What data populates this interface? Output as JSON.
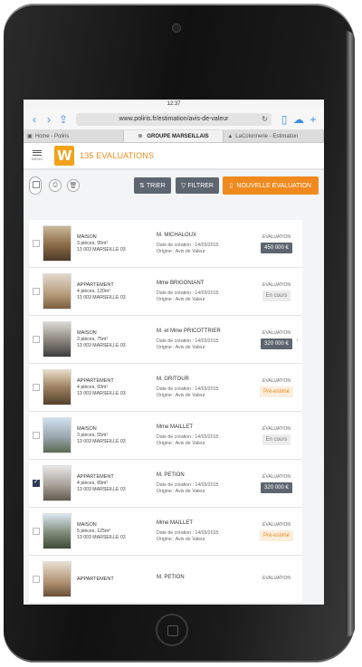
{
  "browser": {
    "time": "12:37",
    "url": "www.poliris.fr/estimation/avis-de-valeur",
    "tabs": [
      {
        "label": "Home - Poliris"
      },
      {
        "label": "GROUPE MARSEILLAIS"
      },
      {
        "label": "LaColonnerie - Estimation"
      }
    ]
  },
  "app": {
    "menu_label": "MENU",
    "evaluations_count": "135 EVALUATIONS"
  },
  "actions": {
    "sort_label": "TRIER",
    "filter_label": "FILTRER",
    "new_label": "NOUVELLE EVALUATION"
  },
  "colors": {
    "accent": "#f08a1f",
    "dark_button": "#5d6670"
  },
  "listings": [
    {
      "type": "MAISON",
      "details": "3 pièces, 95m²",
      "city": "13 003 MARSEILLE 03",
      "owner": "M. MICHALOUX",
      "created": "Date de création : 14/03/2015",
      "origin": "Origine : Avis de Valeur",
      "eval_label": "EVALUATION",
      "status": "450 000 €",
      "status_kind": "price",
      "checked": false
    },
    {
      "type": "APPARTEMENT",
      "details": "4 pièces, 120m²",
      "city": "13 003 MARSEILLE 03",
      "owner": "Mme BRIGONIANT",
      "created": "Date de création : 14/03/2015",
      "origin": "Origine : Avis de Valeur",
      "eval_label": "EVALUATION",
      "status": "En cours",
      "status_kind": "encours",
      "checked": false
    },
    {
      "type": "MAISON",
      "details": "3 pièces, 75m²",
      "city": "13 003 MARSEILLE 03",
      "owner": "M. et Mme PRICOTTRIER",
      "created": "Date de création : 14/03/2015",
      "origin": "Origine : Avis de Valeur",
      "eval_label": "EVALUATION",
      "status": "320 000 €",
      "status_kind": "price",
      "checked": false
    },
    {
      "type": "APPARTEMENT",
      "details": "4 pièces, 93m²",
      "city": "13 003 MARSEILLE 03",
      "owner": "M. GRITOUR",
      "created": "Date de création : 14/03/2015",
      "origin": "Origine : Avis de Valeur",
      "eval_label": "EVALUATION",
      "status": "Pré-estimé",
      "status_kind": "pre",
      "checked": false
    },
    {
      "type": "MAISON",
      "details": "3 pièces, 55m²",
      "city": "13 003 MARSEILLE 03",
      "owner": "Mme MAILLET",
      "created": "Date de création : 14/03/2015",
      "origin": "Origine : Avis de Valeur",
      "eval_label": "EVALUATION",
      "status": "En cours",
      "status_kind": "encours",
      "checked": false
    },
    {
      "type": "APPARTEMENT",
      "details": "4 pièces, 89m²",
      "city": "13 003 MARSEILLE 03",
      "owner": "M. PETION",
      "created": "Date de création : 14/03/2015",
      "origin": "Origine : Avis de Valeur",
      "eval_label": "EVALUATION",
      "status": "320 000 €",
      "status_kind": "price",
      "checked": true
    },
    {
      "type": "MAISON",
      "details": "5 pièces, 125m²",
      "city": "13 003 MARSEILLE 03",
      "owner": "Mme MAILLET",
      "created": "Date de création : 14/03/2015",
      "origin": "Origine : Avis de Valeur",
      "eval_label": "EVALUATION",
      "status": "Pré-estimé",
      "status_kind": "pre",
      "checked": false
    },
    {
      "type": "APPARTEMENT",
      "details": "",
      "city": "",
      "owner": "M. PETION",
      "created": "",
      "origin": "",
      "eval_label": "EVALUATION",
      "status": "",
      "status_kind": "none",
      "checked": false
    }
  ]
}
